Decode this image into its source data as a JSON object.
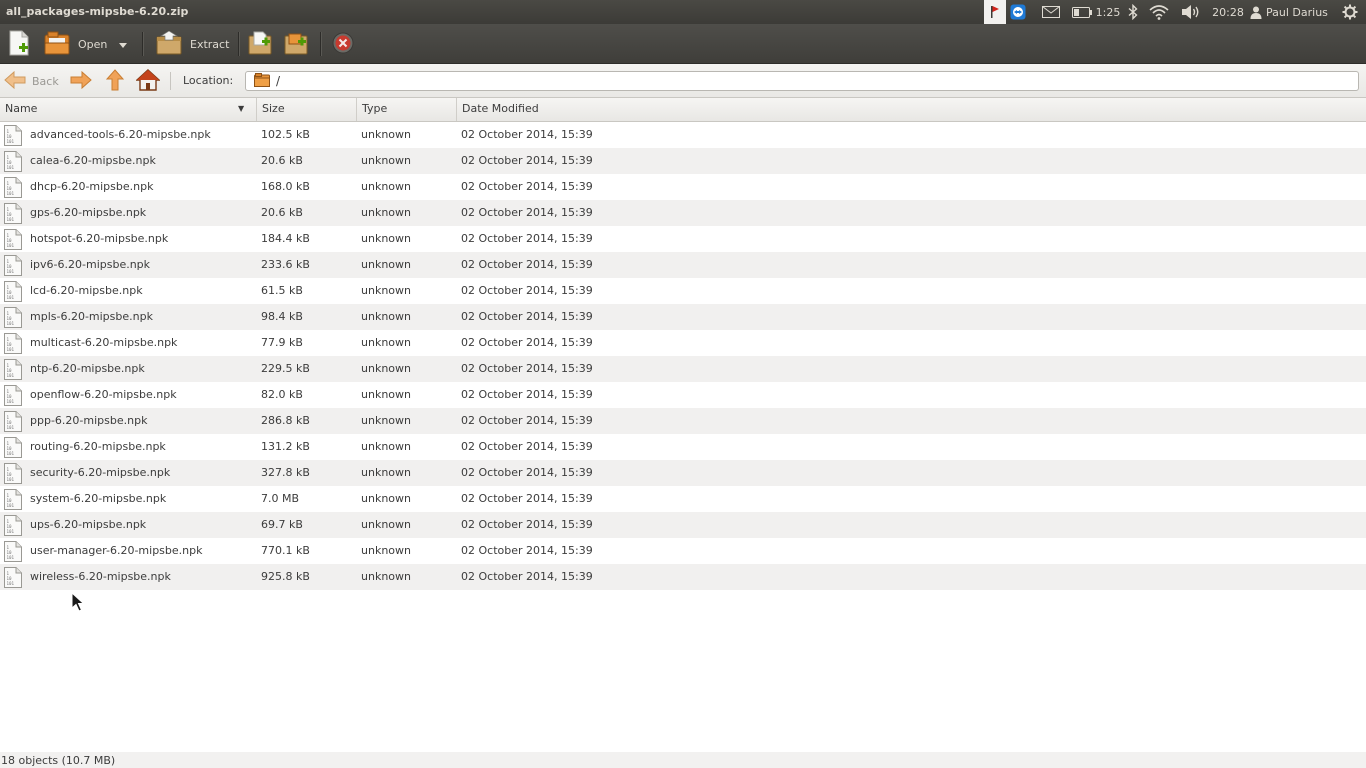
{
  "window": {
    "title": "all_packages-mipsbe-6.20.zip"
  },
  "panel": {
    "battery_time": "1:25",
    "clock": "20:28",
    "user": "Paul Darius",
    "icons": [
      "flag-icon",
      "teamviewer-icon",
      "mail-icon",
      "battery-icon",
      "bluetooth-icon",
      "wifi-icon",
      "volume-icon",
      "user-icon",
      "session-gear-icon"
    ]
  },
  "toolbar": {
    "open_label": "Open",
    "extract_label": "Extract"
  },
  "locbar": {
    "back_label": "Back",
    "location_label": "Location:",
    "location_value": "/"
  },
  "columns": {
    "name": "Name",
    "size": "Size",
    "type": "Type",
    "date": "Date Modified"
  },
  "files": [
    {
      "name": "advanced-tools-6.20-mipsbe.npk",
      "size": "102.5 kB",
      "type": "unknown",
      "date": "02 October 2014, 15:39"
    },
    {
      "name": "calea-6.20-mipsbe.npk",
      "size": "20.6 kB",
      "type": "unknown",
      "date": "02 October 2014, 15:39"
    },
    {
      "name": "dhcp-6.20-mipsbe.npk",
      "size": "168.0 kB",
      "type": "unknown",
      "date": "02 October 2014, 15:39"
    },
    {
      "name": "gps-6.20-mipsbe.npk",
      "size": "20.6 kB",
      "type": "unknown",
      "date": "02 October 2014, 15:39"
    },
    {
      "name": "hotspot-6.20-mipsbe.npk",
      "size": "184.4 kB",
      "type": "unknown",
      "date": "02 October 2014, 15:39"
    },
    {
      "name": "ipv6-6.20-mipsbe.npk",
      "size": "233.6 kB",
      "type": "unknown",
      "date": "02 October 2014, 15:39"
    },
    {
      "name": "lcd-6.20-mipsbe.npk",
      "size": "61.5 kB",
      "type": "unknown",
      "date": "02 October 2014, 15:39"
    },
    {
      "name": "mpls-6.20-mipsbe.npk",
      "size": "98.4 kB",
      "type": "unknown",
      "date": "02 October 2014, 15:39"
    },
    {
      "name": "multicast-6.20-mipsbe.npk",
      "size": "77.9 kB",
      "type": "unknown",
      "date": "02 October 2014, 15:39"
    },
    {
      "name": "ntp-6.20-mipsbe.npk",
      "size": "229.5 kB",
      "type": "unknown",
      "date": "02 October 2014, 15:39"
    },
    {
      "name": "openflow-6.20-mipsbe.npk",
      "size": "82.0 kB",
      "type": "unknown",
      "date": "02 October 2014, 15:39"
    },
    {
      "name": "ppp-6.20-mipsbe.npk",
      "size": "286.8 kB",
      "type": "unknown",
      "date": "02 October 2014, 15:39"
    },
    {
      "name": "routing-6.20-mipsbe.npk",
      "size": "131.2 kB",
      "type": "unknown",
      "date": "02 October 2014, 15:39"
    },
    {
      "name": "security-6.20-mipsbe.npk",
      "size": "327.8 kB",
      "type": "unknown",
      "date": "02 October 2014, 15:39"
    },
    {
      "name": "system-6.20-mipsbe.npk",
      "size": "7.0 MB",
      "type": "unknown",
      "date": "02 October 2014, 15:39"
    },
    {
      "name": "ups-6.20-mipsbe.npk",
      "size": "69.7 kB",
      "type": "unknown",
      "date": "02 October 2014, 15:39"
    },
    {
      "name": "user-manager-6.20-mipsbe.npk",
      "size": "770.1 kB",
      "type": "unknown",
      "date": "02 October 2014, 15:39"
    },
    {
      "name": "wireless-6.20-mipsbe.npk",
      "size": "925.8 kB",
      "type": "unknown",
      "date": "02 October 2014, 15:39"
    }
  ],
  "status": {
    "text": "18 objects (10.7 MB)"
  },
  "colors": {
    "panel_bg": "#3c3b37",
    "toolbar_bg": "#474642",
    "row_alt": "#f1f0ef",
    "arrow_orange": "#f0a258",
    "stop_red": "#c73a2f"
  }
}
